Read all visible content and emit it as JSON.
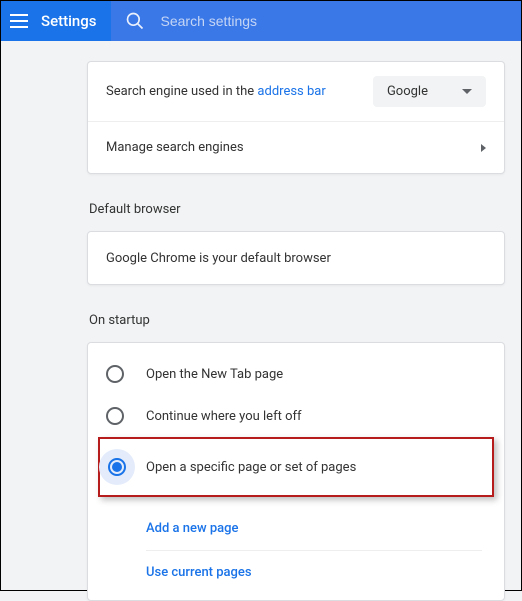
{
  "header": {
    "title": "Settings",
    "search_placeholder": "Search settings"
  },
  "search_engine": {
    "label_prefix": "Search engine used in the ",
    "label_link": "address bar",
    "selected": "Google",
    "manage_label": "Manage search engines"
  },
  "default_browser": {
    "section_title": "Default browser",
    "status": "Google Chrome is your default browser"
  },
  "startup": {
    "section_title": "On startup",
    "options": [
      "Open the New Tab page",
      "Continue where you left off",
      "Open a specific page or set of pages"
    ],
    "add_page_label": "Add a new page",
    "use_current_label": "Use current pages"
  }
}
